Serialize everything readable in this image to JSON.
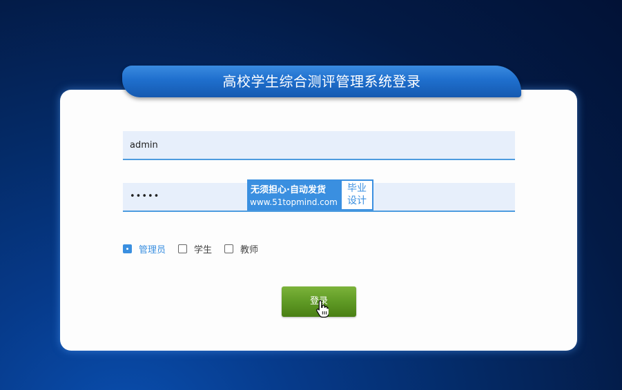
{
  "header": {
    "title": "高校学生综合测评管理系统登录"
  },
  "form": {
    "username_value": "admin",
    "password_display": "•••••"
  },
  "watermark": {
    "line1": "无须担心·自动发货",
    "line2": "www.51topmind.com",
    "box_line1": "毕业",
    "box_line2": "设计"
  },
  "roles": [
    {
      "label": "管理员",
      "selected": true
    },
    {
      "label": "学生",
      "selected": false
    },
    {
      "label": "教师",
      "selected": false
    }
  ],
  "login_button": {
    "label": "登录"
  },
  "colors": {
    "accent": "#3a8fe0",
    "button_green": "#5f9a25",
    "title_blue": "#1f6fcd"
  },
  "icons": {
    "cursor": "hand-pointer-icon"
  }
}
